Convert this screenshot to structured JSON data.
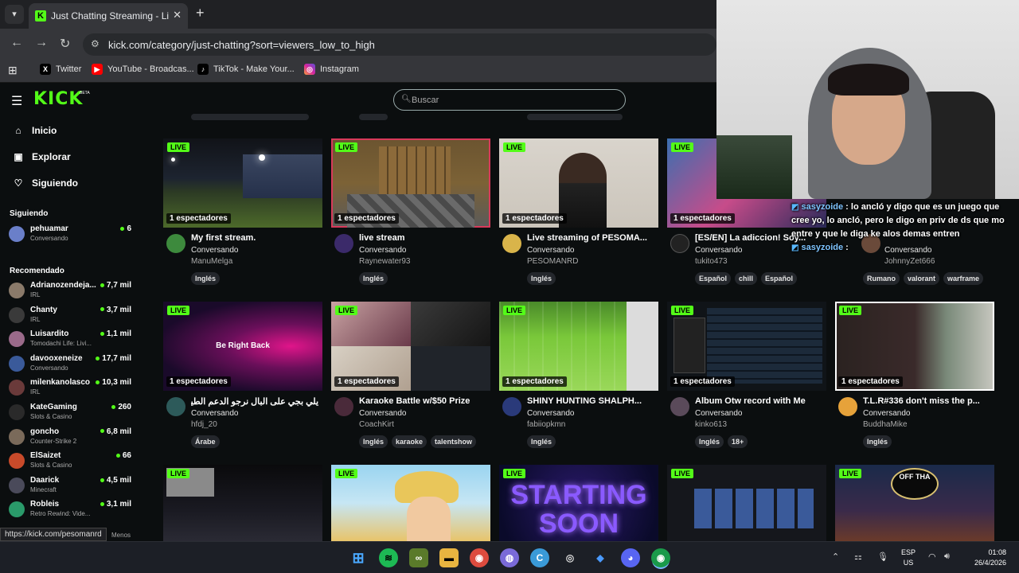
{
  "browser": {
    "tab_title": "Just Chatting Streaming - Live S",
    "url": "kick.com/category/just-chatting?sort=viewers_low_to_high",
    "bookmarks": [
      "Twitter",
      "YouTube - Broadcas...",
      "TikTok - Make Your...",
      "Instagram"
    ],
    "status_url": "https://kick.com/pesomanrd"
  },
  "header": {
    "logo": "KICK",
    "beta": "BETA",
    "search_placeholder": "Buscar"
  },
  "sidebar": {
    "nav": [
      {
        "label": "Inicio",
        "icon": "home-icon"
      },
      {
        "label": "Explorar",
        "icon": "compass-icon"
      },
      {
        "label": "Siguiendo",
        "icon": "heart-icon"
      }
    ],
    "following_title": "Siguiendo",
    "following": [
      {
        "name": "pehuamar",
        "category": "Conversando",
        "viewers": "6"
      }
    ],
    "recommended_title": "Recomendado",
    "recommended": [
      {
        "name": "Adrianozendeja...",
        "category": "IRL",
        "viewers": "7,7 mil"
      },
      {
        "name": "Chanty",
        "category": "IRL",
        "viewers": "3,7 mil"
      },
      {
        "name": "Luisardito",
        "category": "Tomodachi Life: Livi...",
        "viewers": "1,1 mil"
      },
      {
        "name": "davooxeneize",
        "category": "Conversando",
        "viewers": "17,7 mil"
      },
      {
        "name": "milenkanolasco",
        "category": "IRL",
        "viewers": "10,3 mil"
      },
      {
        "name": "KateGaming",
        "category": "Slots & Casino",
        "viewers": "260"
      },
      {
        "name": "goncho",
        "category": "Counter-Strike 2",
        "viewers": "6,8 mil"
      },
      {
        "name": "ElSaizet",
        "category": "Slots & Casino",
        "viewers": "66"
      },
      {
        "name": "Daarick",
        "category": "Minecraft",
        "viewers": "4,5 mil"
      },
      {
        "name": "Robleis",
        "category": "Retro Rewind: Vide...",
        "viewers": "3,1 mil"
      }
    ],
    "show_less": "Menos"
  },
  "streams": {
    "live_label": "LIVE",
    "row1": [
      {
        "viewers": "1 espectadores",
        "title": "My first stream.",
        "category": "Conversando",
        "user": "ManuMelga",
        "tags": [
          "Inglés"
        ]
      },
      {
        "viewers": "1 espectadores",
        "title": "live stream",
        "category": "Conversando",
        "user": "Raynewater93",
        "tags": [
          "Inglés"
        ]
      },
      {
        "viewers": "1 espectadores",
        "title": "Live streaming of PESOMA...",
        "category": "Conversando",
        "user": "PESOMANRD",
        "tags": [
          "Inglés"
        ]
      },
      {
        "viewers": "1 espectadores",
        "title": "[ES/EN] La adiccion! Soy...",
        "category": "Conversando",
        "user": "tukito473",
        "tags": [
          "Español",
          "chill",
          "Español"
        ]
      },
      {
        "viewers": "",
        "title": "",
        "category": "Conversando",
        "user": "JohnnyZet666",
        "tags": [
          "Rumano",
          "valorant",
          "warframe"
        ]
      }
    ],
    "row2": [
      {
        "viewers": "1 espectadores",
        "thumb_text": "Be Right Back",
        "title": "يلي بجي على البال نرجو الدعم الطيف...",
        "category": "Conversando",
        "user": "hfdj_20",
        "tags": [
          "Árabe"
        ]
      },
      {
        "viewers": "1 espectadores",
        "title": "Karaoke Battle w/$50 Prize",
        "category": "Conversando",
        "user": "CoachKirt",
        "tags": [
          "Inglés",
          "karaoke",
          "talentshow"
        ]
      },
      {
        "viewers": "1 espectadores",
        "title": "SHINY HUNTING SHALPH...",
        "category": "Conversando",
        "user": "fabiiopkmn",
        "tags": [
          "Inglés"
        ]
      },
      {
        "viewers": "1 espectadores",
        "title": "Album Otw record with Me",
        "category": "Conversando",
        "user": "kinko613",
        "tags": [
          "Inglés",
          "18+"
        ]
      },
      {
        "viewers": "1 espectadores",
        "title": "T.L.R#336 don't miss the p...",
        "category": "Conversando",
        "user": "BuddhaMike",
        "tags": [
          "Inglés"
        ]
      }
    ],
    "row3_thumb_texts": [
      "STARTING SOON",
      "OFF THA"
    ]
  },
  "chat": [
    {
      "user": "sasyzoide",
      "text": "lo ancló y digo que es un juego que cree yo, lo ancló, pero le digo en priv de ds que mo entre y que le diga ke alos demas entren"
    },
    {
      "user": "sasyzoide",
      "text": ""
    }
  ],
  "taskbar": {
    "lang_line1": "ESP",
    "lang_line2": "US",
    "time": "01:08",
    "date": "26/4/2026"
  },
  "colors": {
    "kick_green": "#53fc18",
    "background": "#0b0e0f"
  }
}
